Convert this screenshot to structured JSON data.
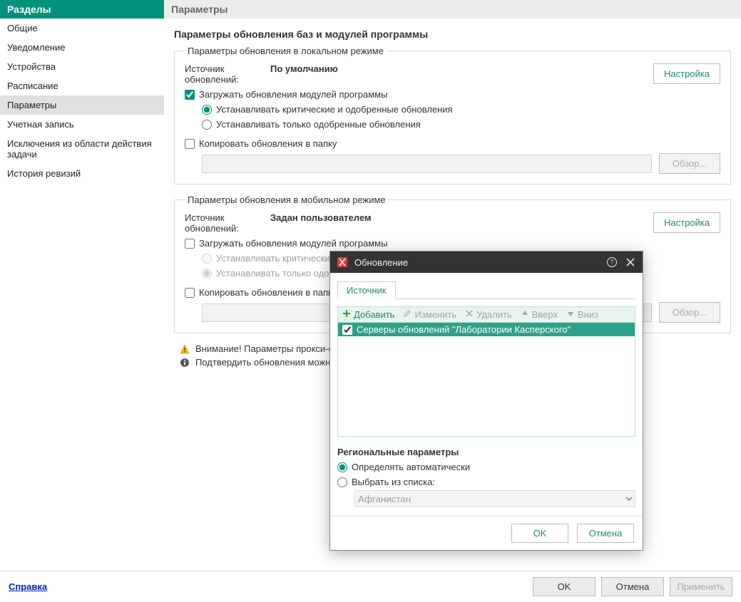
{
  "sidebar": {
    "title": "Разделы",
    "items": [
      {
        "label": "Общие"
      },
      {
        "label": "Уведомление"
      },
      {
        "label": "Устройства"
      },
      {
        "label": "Расписание"
      },
      {
        "label": "Параметры"
      },
      {
        "label": "Учетная запись"
      },
      {
        "label": "Исключения из области действия задачи"
      },
      {
        "label": "История ревизий"
      }
    ],
    "selected_index": 4
  },
  "main": {
    "header": "Параметры",
    "section_title": "Параметры обновления баз и модулей программы",
    "groups": {
      "local": {
        "legend": "Параметры обновления в локальном режиме",
        "source_label": "Источник обновлений:",
        "source_value": "По умолчанию",
        "settings_button": "Настройка",
        "download_modules": {
          "label": "Загружать обновления модулей программы",
          "checked": true
        },
        "radio_critical": {
          "label": "Устанавливать критические и одобренные обновления",
          "selected": true
        },
        "radio_approved": {
          "label": "Устанавливать только одобренные обновления",
          "selected": false
        },
        "copy_to_folder": {
          "label": "Копировать обновления в папку",
          "checked": false
        },
        "browse_button": "Обзор...",
        "path_value": ""
      },
      "mobile": {
        "legend": "Параметры обновления в мобильном режиме",
        "source_label": "Источник обновлений:",
        "source_value": "Задан пользователем",
        "settings_button": "Настройка",
        "download_modules": {
          "label": "Загружать обновления модулей программы",
          "checked": false
        },
        "radio_critical": {
          "label": "Устанавливать критические и одобренные обновления"
        },
        "radio_approved": {
          "label": "Устанавливать только одобренные обновления"
        },
        "copy_to_folder": {
          "label": "Копировать обновления в папку",
          "checked": false
        },
        "browse_button": "Обзор...",
        "path_value": ""
      }
    },
    "notes": {
      "warn": "Внимание! Параметры прокси-серв",
      "info": "Подтвердить обновления можно в"
    }
  },
  "footer": {
    "help": "Справка",
    "ok": "OK",
    "cancel": "Отмена",
    "apply": "Применить"
  },
  "modal": {
    "title": "Обновление",
    "tab_source": "Источник",
    "toolbar": {
      "add": "Добавить",
      "edit": "Изменить",
      "delete": "Удалить",
      "up": "Вверх",
      "down": "Вниз"
    },
    "list_item": "Серверы обновлений \"Лаборатории Касперского\"",
    "regional_title": "Региональные параметры",
    "radio_auto": "Определять автоматически",
    "radio_list": "Выбрать из списка:",
    "country": "Афганистан",
    "ok": "OK",
    "cancel": "Отмена"
  }
}
